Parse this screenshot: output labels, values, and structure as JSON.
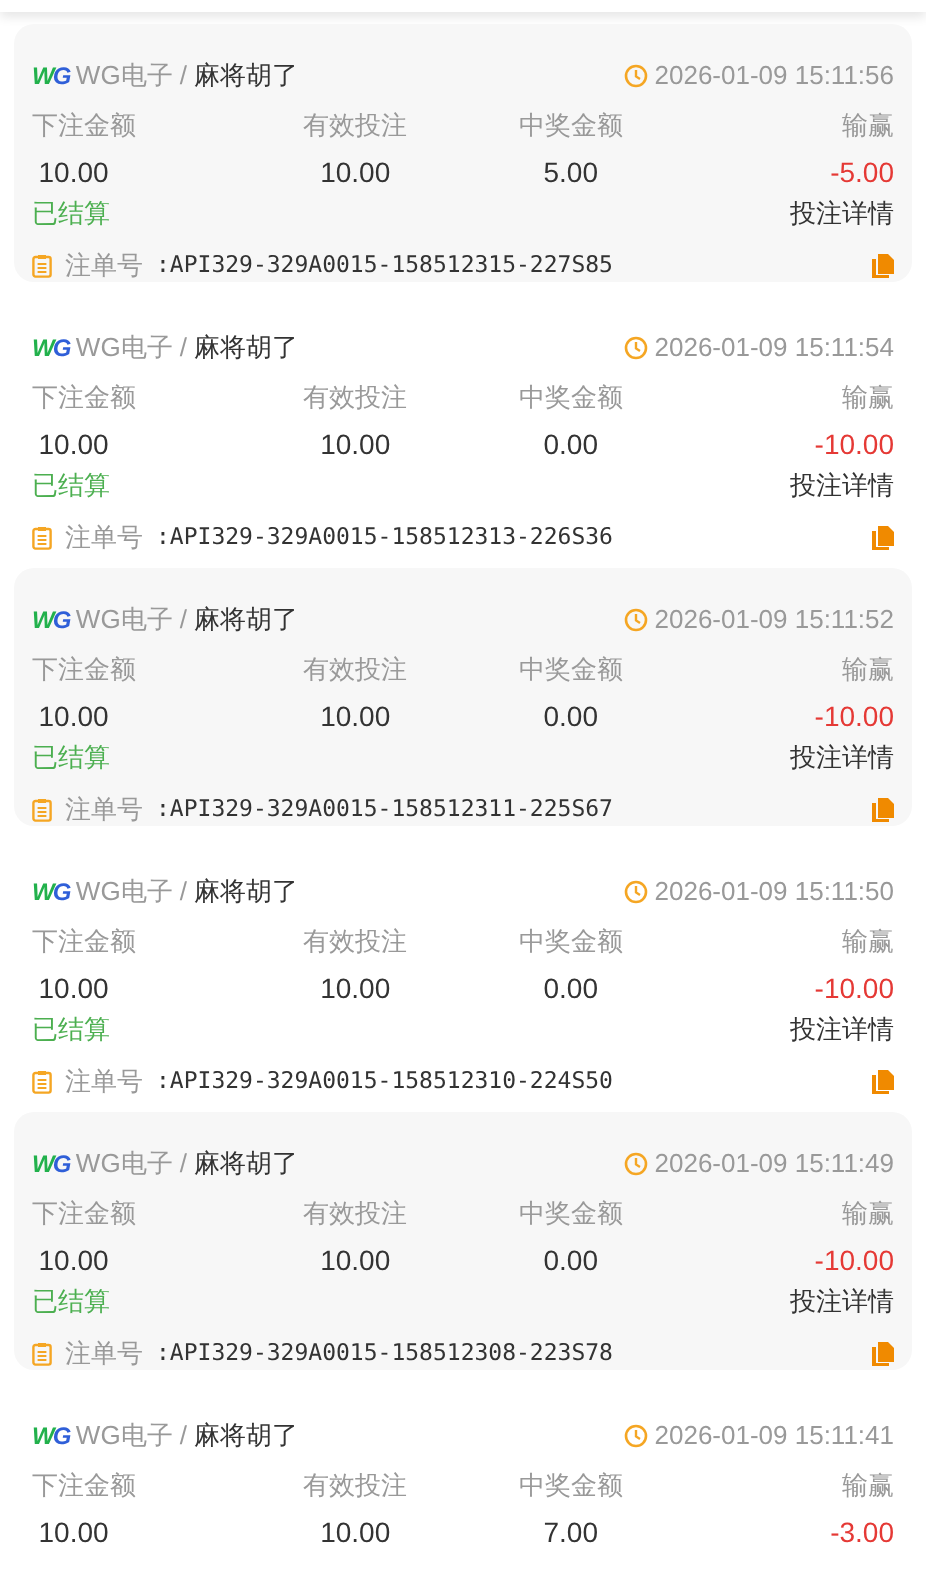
{
  "records": [
    {
      "logo": "WG",
      "provider": "WG电子 /",
      "game": "麻将胡了",
      "time": "2026-01-09 15:11:56",
      "columns": [
        {
          "label": "下注金额",
          "value": "10.00"
        },
        {
          "label": "有效投注",
          "value": "10.00"
        },
        {
          "label": "中奖金额",
          "value": "5.00"
        },
        {
          "label": "输赢",
          "value": "-5.00",
          "color": "#e53935"
        }
      ],
      "status": "已结算",
      "details": "投注详情",
      "order_label": "注单号",
      "order_no": ":API329-329A0015-158512315-227S85"
    },
    {
      "logo": "WG",
      "provider": "WG电子 /",
      "game": "麻将胡了",
      "time": "2026-01-09 15:11:54",
      "columns": [
        {
          "label": "下注金额",
          "value": "10.00"
        },
        {
          "label": "有效投注",
          "value": "10.00"
        },
        {
          "label": "中奖金额",
          "value": "0.00"
        },
        {
          "label": "输赢",
          "value": "-10.00",
          "color": "#e53935"
        }
      ],
      "status": "已结算",
      "details": "投注详情",
      "order_label": "注单号",
      "order_no": ":API329-329A0015-158512313-226S36"
    },
    {
      "logo": "WG",
      "provider": "WG电子 /",
      "game": "麻将胡了",
      "time": "2026-01-09 15:11:52",
      "columns": [
        {
          "label": "下注金额",
          "value": "10.00"
        },
        {
          "label": "有效投注",
          "value": "10.00"
        },
        {
          "label": "中奖金额",
          "value": "0.00"
        },
        {
          "label": "输赢",
          "value": "-10.00",
          "color": "#e53935"
        }
      ],
      "status": "已结算",
      "details": "投注详情",
      "order_label": "注单号",
      "order_no": ":API329-329A0015-158512311-225S67"
    },
    {
      "logo": "WG",
      "provider": "WG电子 /",
      "game": "麻将胡了",
      "time": "2026-01-09 15:11:50",
      "columns": [
        {
          "label": "下注金额",
          "value": "10.00"
        },
        {
          "label": "有效投注",
          "value": "10.00"
        },
        {
          "label": "中奖金额",
          "value": "0.00"
        },
        {
          "label": "输赢",
          "value": "-10.00",
          "color": "#e53935"
        }
      ],
      "status": "已结算",
      "details": "投注详情",
      "order_label": "注单号",
      "order_no": ":API329-329A0015-158512310-224S50"
    },
    {
      "logo": "WG",
      "provider": "WG电子 /",
      "game": "麻将胡了",
      "time": "2026-01-09 15:11:49",
      "columns": [
        {
          "label": "下注金额",
          "value": "10.00"
        },
        {
          "label": "有效投注",
          "value": "10.00"
        },
        {
          "label": "中奖金额",
          "value": "0.00"
        },
        {
          "label": "输赢",
          "value": "-10.00",
          "color": "#e53935"
        }
      ],
      "status": "已结算",
      "details": "投注详情",
      "order_label": "注单号",
      "order_no": ":API329-329A0015-158512308-223S78"
    },
    {
      "logo": "WG",
      "provider": "WG电子 /",
      "game": "麻将胡了",
      "time": "2026-01-09 15:11:41",
      "columns": [
        {
          "label": "下注金额",
          "value": "10.00"
        },
        {
          "label": "有效投注",
          "value": "10.00"
        },
        {
          "label": "中奖金额",
          "value": "7.00"
        },
        {
          "label": "输赢",
          "value": "-3.00",
          "color": "#e53935"
        }
      ]
    }
  ]
}
